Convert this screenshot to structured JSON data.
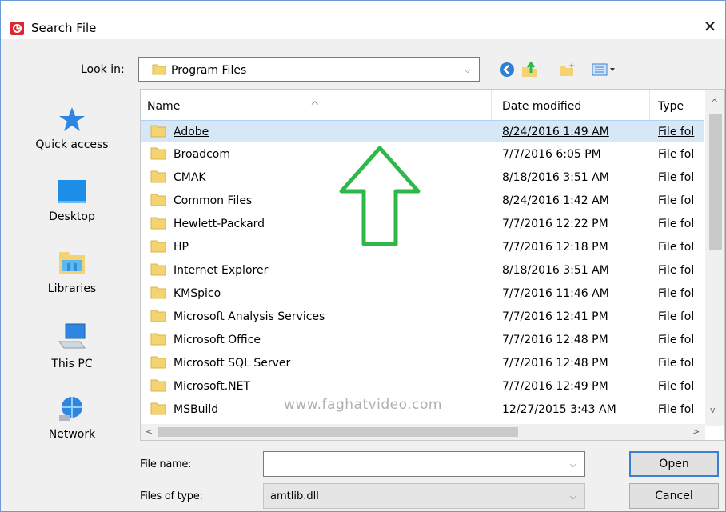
{
  "window": {
    "title": "Search File",
    "close_glyph": "✕"
  },
  "lookin": {
    "label": "Look in:",
    "value": "Program Files"
  },
  "toolbar": {
    "icons": [
      "back-icon",
      "up-folder-icon",
      "new-folder-icon",
      "view-menu-icon"
    ]
  },
  "places": [
    {
      "label": "Quick access",
      "icon": "star-icon"
    },
    {
      "label": "Desktop",
      "icon": "desktop-icon"
    },
    {
      "label": "Libraries",
      "icon": "libraries-icon"
    },
    {
      "label": "This PC",
      "icon": "computer-icon"
    },
    {
      "label": "Network",
      "icon": "network-icon"
    }
  ],
  "columns": {
    "name": "Name",
    "date": "Date modified",
    "type": "Type"
  },
  "files": [
    {
      "name": "Adobe",
      "date": "8/24/2016 1:49 AM",
      "type": "File fol"
    },
    {
      "name": "Broadcom",
      "date": "7/7/2016 6:05 PM",
      "type": "File fol"
    },
    {
      "name": "CMAK",
      "date": "8/18/2016 3:51 AM",
      "type": "File fol"
    },
    {
      "name": "Common Files",
      "date": "8/24/2016 1:42 AM",
      "type": "File fol"
    },
    {
      "name": "Hewlett-Packard",
      "date": "7/7/2016 12:22 PM",
      "type": "File fol"
    },
    {
      "name": "HP",
      "date": "7/7/2016 12:18 PM",
      "type": "File fol"
    },
    {
      "name": "Internet Explorer",
      "date": "8/18/2016 3:51 AM",
      "type": "File fol"
    },
    {
      "name": "KMSpico",
      "date": "7/7/2016 11:46 AM",
      "type": "File fol"
    },
    {
      "name": "Microsoft Analysis Services",
      "date": "7/7/2016 12:41 PM",
      "type": "File fol"
    },
    {
      "name": "Microsoft Office",
      "date": "7/7/2016 12:48 PM",
      "type": "File fol"
    },
    {
      "name": "Microsoft SQL Server",
      "date": "7/7/2016 12:48 PM",
      "type": "File fol"
    },
    {
      "name": "Microsoft.NET",
      "date": "7/7/2016 12:49 PM",
      "type": "File fol"
    },
    {
      "name": "MSBuild",
      "date": "12/27/2015 3:43 AM",
      "type": "File fol"
    }
  ],
  "selected_index": 0,
  "watermark": "www.faghatvideo.com",
  "filename": {
    "label": "File name:",
    "value": ""
  },
  "filetype": {
    "label": "Files of type:",
    "value": "amtlib.dll"
  },
  "buttons": {
    "open": "Open",
    "cancel": "Cancel"
  },
  "colors": {
    "selection": "#d6e8f8",
    "arrow": "#2eb84a",
    "folder": "#f4d472",
    "accent": "#3c7fd1"
  }
}
